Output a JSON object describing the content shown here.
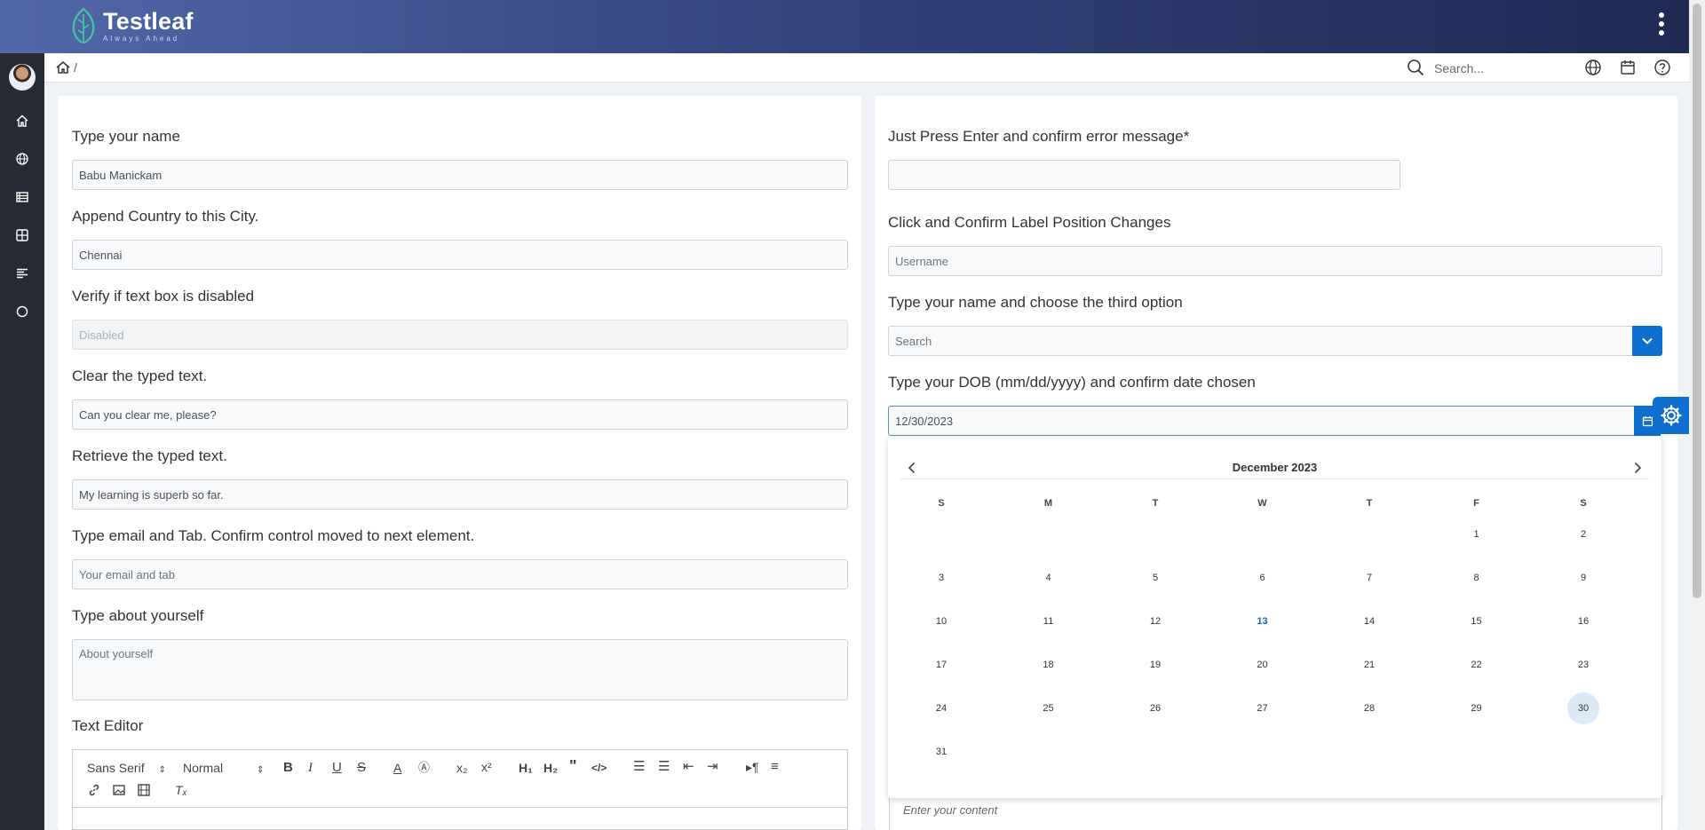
{
  "header": {
    "brand": "Testleaf",
    "tagline": "Always Ahead"
  },
  "topbar": {
    "search_placeholder": "Search...",
    "breadcrumb_sep": "/"
  },
  "left": {
    "fields": [
      {
        "label": "Type your name",
        "value": "Babu Manickam",
        "placeholder": ""
      },
      {
        "label": "Append Country to this City.",
        "value": "Chennai",
        "placeholder": ""
      },
      {
        "label": "Verify if text box is disabled",
        "value": "",
        "placeholder": "Disabled"
      },
      {
        "label": "Clear the typed text.",
        "value": "Can you clear me, please?",
        "placeholder": ""
      },
      {
        "label": "Retrieve the typed text.",
        "value": "My learning is superb so far.",
        "placeholder": ""
      },
      {
        "label": "Type email and Tab. Confirm control moved to next element.",
        "value": "",
        "placeholder": "Your email and tab"
      },
      {
        "label": "Type about yourself",
        "value": "",
        "placeholder": "About yourself"
      }
    ],
    "editor": {
      "label": "Text Editor",
      "font": "Sans Serif",
      "size": "Normal"
    }
  },
  "right": {
    "fields": [
      {
        "label": "Just Press Enter and confirm error message*",
        "value": "",
        "placeholder": ""
      },
      {
        "label": "Click and Confirm Label Position Changes",
        "value": "",
        "placeholder": "Username"
      },
      {
        "label": "Type your name and choose the third option",
        "value": "",
        "placeholder": "Search"
      },
      {
        "label": "Type your DOB (mm/dd/yyyy) and confirm date chosen",
        "value": "12/30/2023",
        "placeholder": ""
      }
    ],
    "editor_placeholder": "Enter your content"
  },
  "calendar": {
    "title": "December 2023",
    "weekdays": [
      "S",
      "M",
      "T",
      "W",
      "T",
      "F",
      "S"
    ],
    "days": [
      "1",
      "2",
      "3",
      "4",
      "5",
      "6",
      "7",
      "8",
      "9",
      "10",
      "11",
      "12",
      "13",
      "14",
      "15",
      "16",
      "17",
      "18",
      "19",
      "20",
      "21",
      "22",
      "23",
      "24",
      "25",
      "26",
      "27",
      "28",
      "29",
      "30",
      "31"
    ],
    "first_weekday": 5,
    "today": "13",
    "selected": "30"
  },
  "colors": {
    "accent": "#0f6fcf",
    "header_start": "#5168a9",
    "header_end": "#1f2a52",
    "sidebar": "#252a34"
  }
}
